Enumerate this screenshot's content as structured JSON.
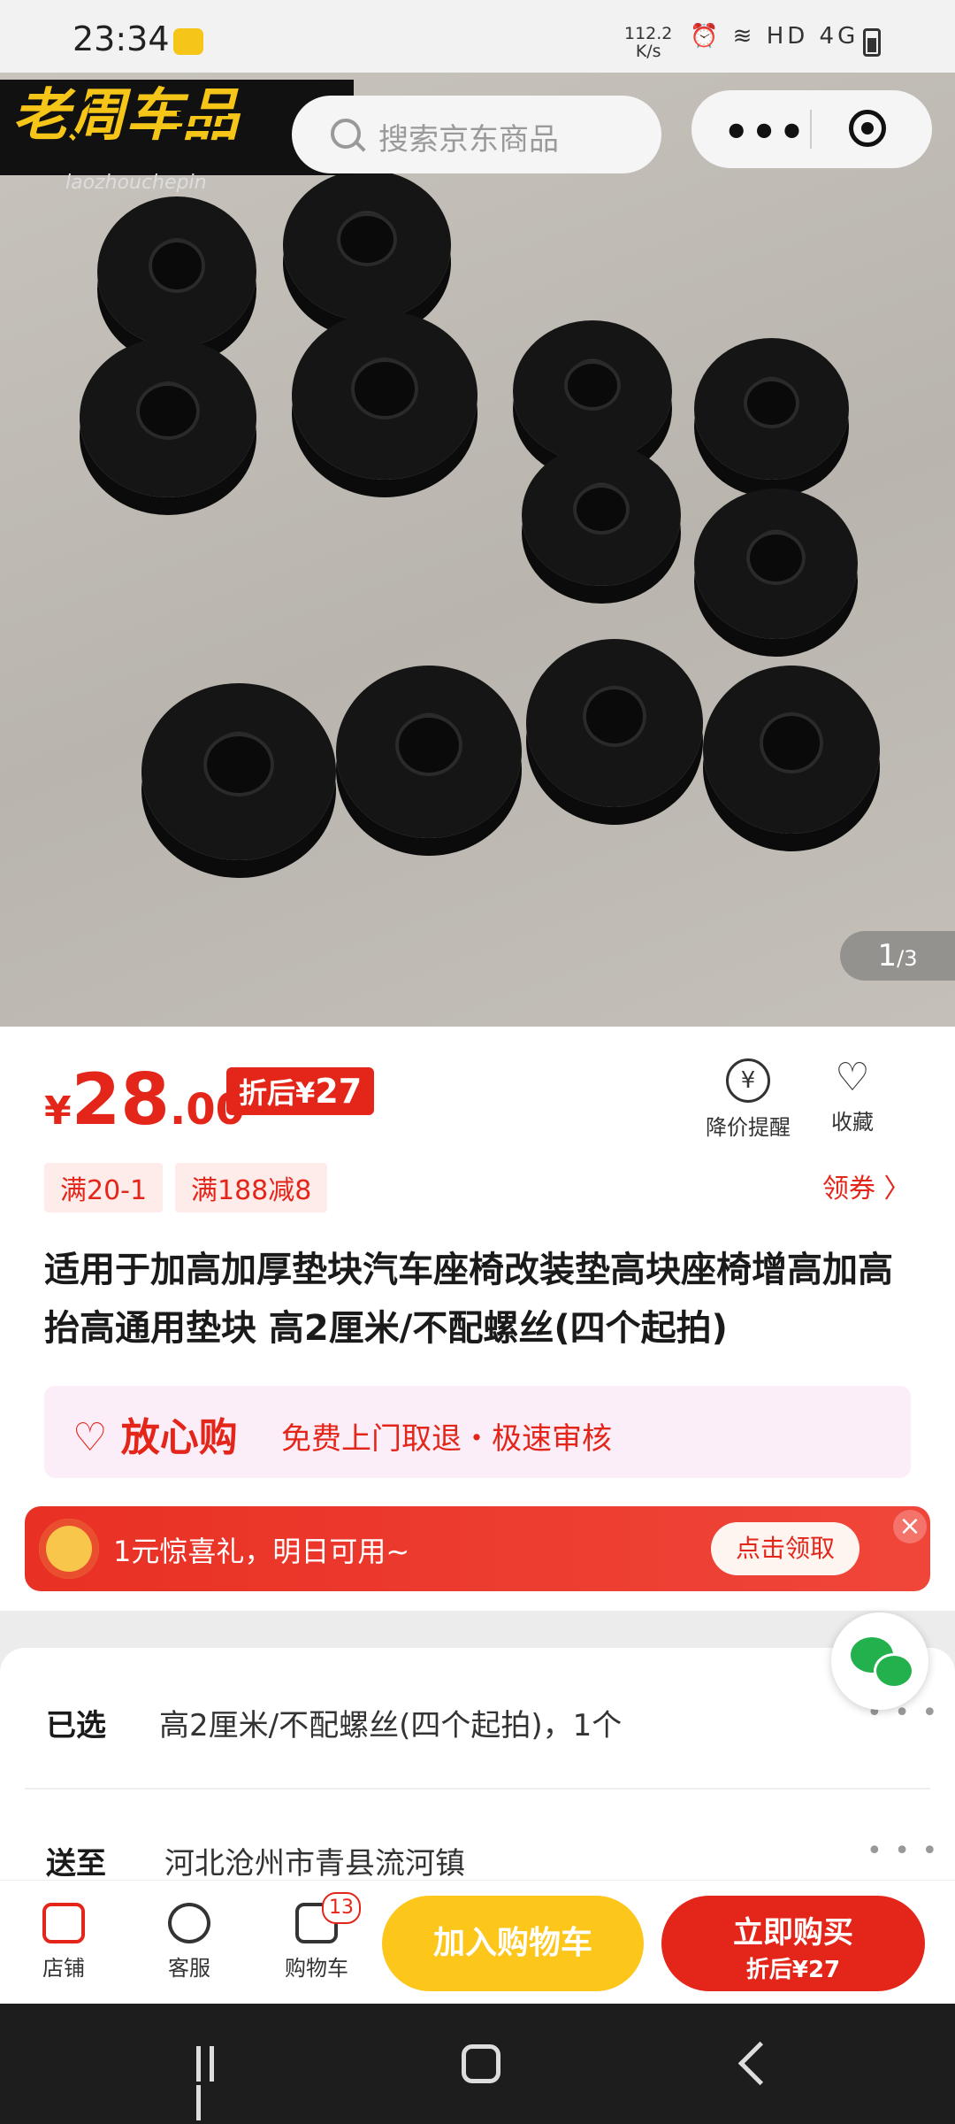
{
  "status_bar": {
    "time": "23:34",
    "net_speed": "112.2",
    "net_unit": "K/s",
    "icons_text": "⏰ ≋ HD 4G"
  },
  "header": {
    "logo_text": "老周车品",
    "logo_sub": "laozhouchepin",
    "search_placeholder": "搜索京东商品",
    "more_label": "•••"
  },
  "gallery": {
    "current": "1",
    "total": "/3"
  },
  "price": {
    "currency": "¥",
    "integer": "28",
    "decimal": ".00",
    "after_label": "折后",
    "after_currency": "¥",
    "after_value": "27"
  },
  "actions": {
    "price_alert_label": "降价提醒",
    "favorite_label": "收藏",
    "price_alert_glyph": "¥",
    "favorite_glyph": "♡"
  },
  "coupons": {
    "items": [
      "满20-1",
      "满188减8"
    ],
    "get_label": "领券 〉"
  },
  "product": {
    "title": "适用于加高加厚垫块汽车座椅改装垫高块座椅增高加高抬高通用垫块 高2厘米/不配螺丝(四个起拍)"
  },
  "assurance": {
    "icon": "♡",
    "name": "放心购",
    "desc": "免费上门取退・极速审核"
  },
  "gift_banner": {
    "message": "1元惊喜礼，明日可用~",
    "claim_label": "点击领取",
    "close_glyph": "×"
  },
  "options": {
    "selected_label": "已选",
    "selected_value": "高2厘米/不配螺丝(四个起拍)，1个",
    "ship_label": "送至",
    "ship_value": "河北沧州市青县流河镇",
    "more_glyph": "• • •"
  },
  "bottom_bar": {
    "store_label": "店铺",
    "service_label": "客服",
    "cart_label": "购物车",
    "cart_count": "13",
    "add_cart_label": "加入购物车",
    "buy_now_label": "立即购买",
    "buy_now_sub": "折后¥27"
  },
  "colors": {
    "accent_red": "#e4251a",
    "cart_yellow": "#fdc61b"
  }
}
